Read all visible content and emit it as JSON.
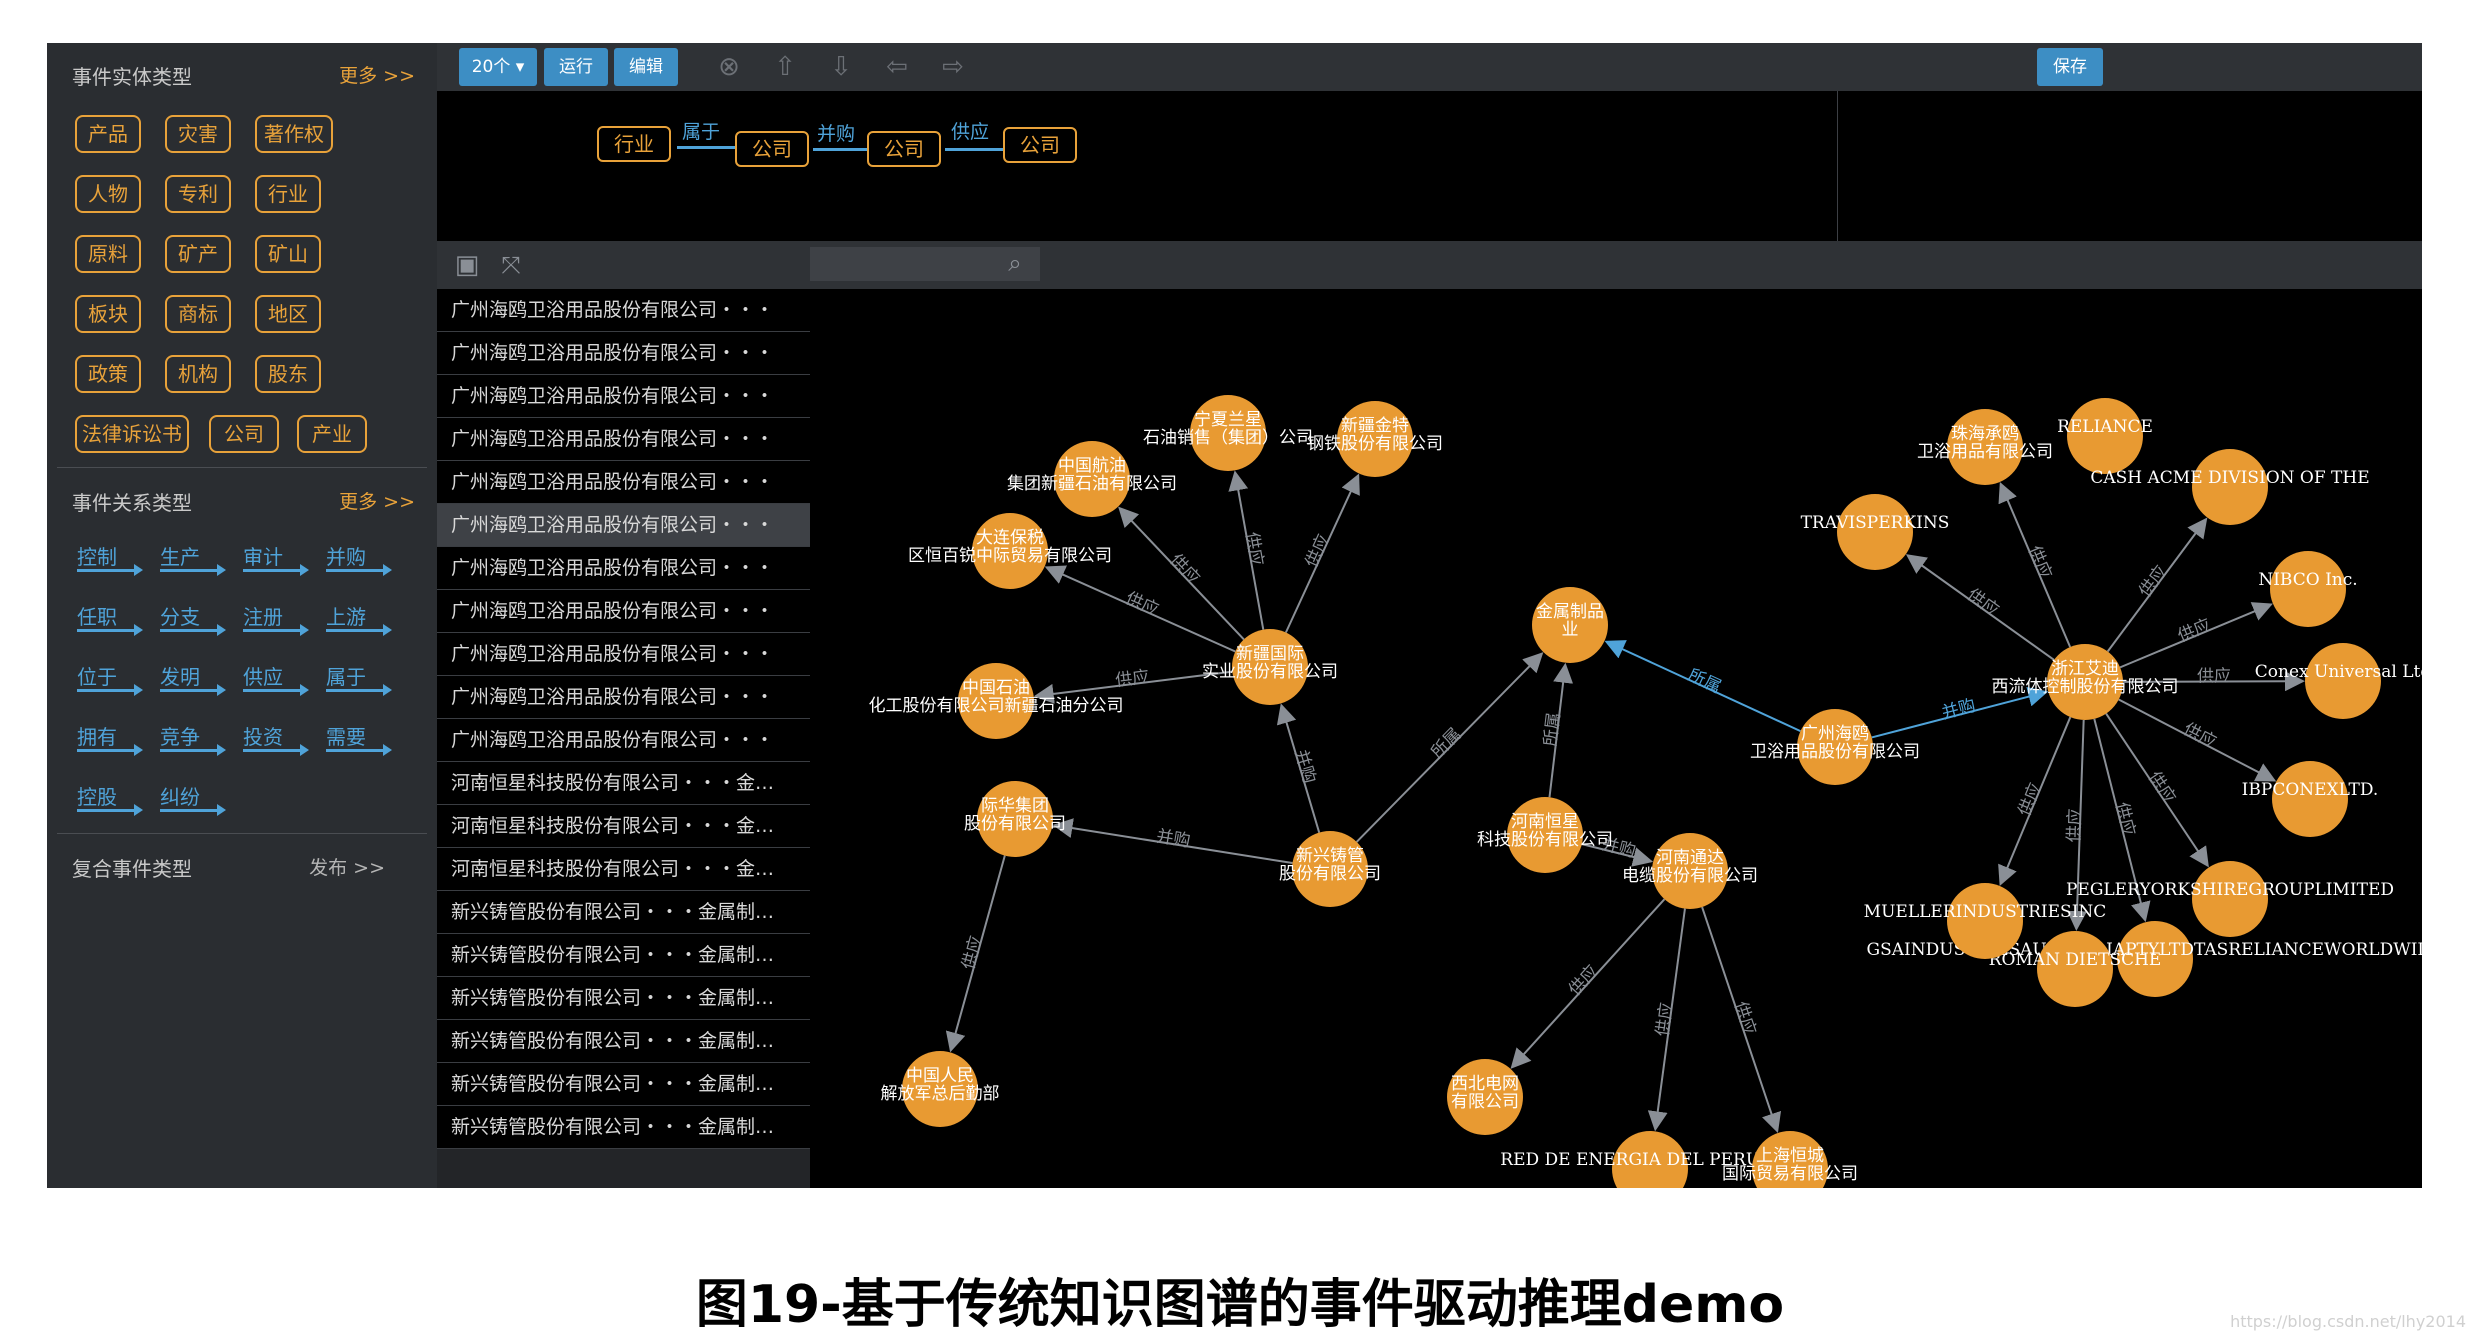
{
  "sidebar": {
    "entity_title": "事件实体类型",
    "entity_more": "更多 >>",
    "entity_types": [
      "产品",
      "灾害",
      "著作权",
      "人物",
      "专利",
      "行业",
      "原料",
      "矿产",
      "矿山",
      "板块",
      "商标",
      "地区",
      "政策",
      "机构",
      "股东",
      "法律诉讼书",
      "公司",
      "产业"
    ],
    "relation_title": "事件关系类型",
    "relation_more": "更多 >>",
    "relation_types": [
      "控制",
      "生产",
      "审计",
      "并购",
      "任职",
      "分支",
      "注册",
      "上游",
      "位于",
      "发明",
      "供应",
      "属于",
      "拥有",
      "竞争",
      "投资",
      "需要",
      "控股",
      "纠纷"
    ],
    "composite_title": "复合事件类型",
    "composite_more": "发布 >>"
  },
  "toolbar": {
    "count_label": "20个",
    "run_label": "运行",
    "edit_label": "编辑",
    "save_label": "保存"
  },
  "pattern": {
    "nodes": [
      "行业",
      "公司",
      "公司",
      "公司"
    ],
    "edges": [
      "属于",
      "并购",
      "供应"
    ]
  },
  "list_rows": [
    "广州海鸥卫浴用品股份有限公司・・・",
    "广州海鸥卫浴用品股份有限公司・・・",
    "广州海鸥卫浴用品股份有限公司・・・",
    "广州海鸥卫浴用品股份有限公司・・・",
    "广州海鸥卫浴用品股份有限公司・・・",
    "广州海鸥卫浴用品股份有限公司・・・",
    "广州海鸥卫浴用品股份有限公司・・・",
    "广州海鸥卫浴用品股份有限公司・・・",
    "广州海鸥卫浴用品股份有限公司・・・",
    "广州海鸥卫浴用品股份有限公司・・・",
    "广州海鸥卫浴用品股份有限公司・・・",
    "河南恒星科技股份有限公司・・・金…",
    "河南恒星科技股份有限公司・・・金…",
    "河南恒星科技股份有限公司・・・金…",
    "新兴铸管股份有限公司・・・金属制…",
    "新兴铸管股份有限公司・・・金属制…",
    "新兴铸管股份有限公司・・・金属制…",
    "新兴铸管股份有限公司・・・金属制…",
    "新兴铸管股份有限公司・・・金属制…",
    "新兴铸管股份有限公司・・・金属制…"
  ],
  "graph": {
    "nodes": [
      {
        "id": "xj",
        "lines": [
          "新疆国际",
          "实业股份有限公司"
        ]
      },
      {
        "id": "zhhy",
        "lines": [
          "中国航油",
          "集团新疆石油有限公司"
        ]
      },
      {
        "id": "nxxl",
        "lines": [
          "宁夏兰星",
          "石油销售（集团）公司"
        ]
      },
      {
        "id": "xjjt",
        "lines": [
          "新疆金特",
          "钢铁股份有限公司"
        ]
      },
      {
        "id": "dlbs",
        "lines": [
          "大连保税",
          "区恒百锐中际贸易有限公司"
        ]
      },
      {
        "id": "zgsy",
        "lines": [
          "中国石油",
          "化工股份有限公司新疆石油分公司"
        ]
      },
      {
        "id": "jhjt",
        "lines": [
          "际华集团",
          "股份有限公司"
        ]
      },
      {
        "id": "zgrm",
        "lines": [
          "中国人民",
          "解放军总后勤部"
        ]
      },
      {
        "id": "xxzg",
        "lines": [
          "新兴铸管",
          "股份有限公司"
        ]
      },
      {
        "id": "jszp",
        "lines": [
          "金属制品",
          "业"
        ]
      },
      {
        "id": "hnhx",
        "lines": [
          "河南恒星",
          "科技股份有限公司"
        ]
      },
      {
        "id": "hntd",
        "lines": [
          "河南通达",
          "电缆股份有限公司"
        ]
      },
      {
        "id": "xbdw",
        "lines": [
          "西北电网",
          "有限公司"
        ]
      },
      {
        "id": "red",
        "lines": [
          "RED DE ENERGIA DEL PERU S.A."
        ]
      },
      {
        "id": "shhc",
        "lines": [
          "上海恒城",
          "国际贸易有限公司"
        ]
      },
      {
        "id": "gzhy",
        "lines": [
          "广州海鸥",
          "卫浴用品股份有限公司"
        ]
      },
      {
        "id": "zjad",
        "lines": [
          "浙江艾迪",
          "西流体控制股份有限公司"
        ]
      },
      {
        "id": "zhcq",
        "lines": [
          "珠海承鸥",
          "卫浴用品有限公司"
        ]
      },
      {
        "id": "rel",
        "lines": [
          "RELIANCE"
        ]
      },
      {
        "id": "cash",
        "lines": [
          "CASH ACME DIVISION OF THE"
        ]
      },
      {
        "id": "trav",
        "lines": [
          "TRAVISPERKINS"
        ]
      },
      {
        "id": "nibco",
        "lines": [
          "NIBCO Inc."
        ]
      },
      {
        "id": "conex",
        "lines": [
          "Conex Universal Ltd"
        ]
      },
      {
        "id": "ibp",
        "lines": [
          "IBPCONEXLTD."
        ]
      },
      {
        "id": "pegler",
        "lines": [
          "PEGLERYORKSHIREGROUPLIMITED"
        ]
      },
      {
        "id": "gsa",
        "lines": [
          "GSAINDUSTRIESAUSTRALIAPTYLTDTASRELIANCEWORLDWIDE"
        ]
      },
      {
        "id": "rom",
        "lines": [
          "ROMAN DIETSCHE"
        ]
      },
      {
        "id": "mue",
        "lines": [
          "MUELLERINDUSTRIESINC"
        ]
      }
    ],
    "edges": [
      {
        "from": "xj",
        "to": "zhhy",
        "label": "供应"
      },
      {
        "from": "xj",
        "to": "nxxl",
        "label": "供应"
      },
      {
        "from": "xj",
        "to": "xjjt",
        "label": "供应"
      },
      {
        "from": "xj",
        "to": "dlbs",
        "label": "供应"
      },
      {
        "from": "xj",
        "to": "zgsy",
        "label": "供应"
      },
      {
        "from": "xxzg",
        "to": "xj",
        "label": "并购"
      },
      {
        "from": "xxzg",
        "to": "jhjt",
        "label": "并购"
      },
      {
        "from": "jhjt",
        "to": "zgrm",
        "label": "供应"
      },
      {
        "from": "xxzg",
        "to": "jszp",
        "label": "所属"
      },
      {
        "from": "hnhx",
        "to": "jszp",
        "label": "所属"
      },
      {
        "from": "hnhx",
        "to": "hntd",
        "label": "并购"
      },
      {
        "from": "hntd",
        "to": "xbdw",
        "label": "供应"
      },
      {
        "from": "hntd",
        "to": "red",
        "label": "供应"
      },
      {
        "from": "hntd",
        "to": "shhc",
        "label": "供应"
      },
      {
        "from": "gzhy",
        "to": "jszp",
        "label": "所属"
      },
      {
        "from": "gzhy",
        "to": "zjad",
        "label": "并购"
      },
      {
        "from": "zjad",
        "to": "zhcq",
        "label": "供应"
      },
      {
        "from": "zjad",
        "to": "trav",
        "label": "供应"
      },
      {
        "from": "zjad",
        "to": "cash",
        "label": "供应"
      },
      {
        "from": "zjad",
        "to": "nibco",
        "label": "供应"
      },
      {
        "from": "zjad",
        "to": "conex",
        "label": "供应"
      },
      {
        "from": "zjad",
        "to": "ibp",
        "label": "供应"
      },
      {
        "from": "zjad",
        "to": "pegler",
        "label": "供应"
      },
      {
        "from": "zjad",
        "to": "gsa",
        "label": "供应"
      },
      {
        "from": "zjad",
        "to": "rom",
        "label": "供应"
      },
      {
        "from": "zjad",
        "to": "mue",
        "label": "供应"
      }
    ]
  },
  "caption": "图19-基于传统知识图谱的事件驱动推理demo",
  "watermark": "https://blog.csdn.net/lhy2014"
}
